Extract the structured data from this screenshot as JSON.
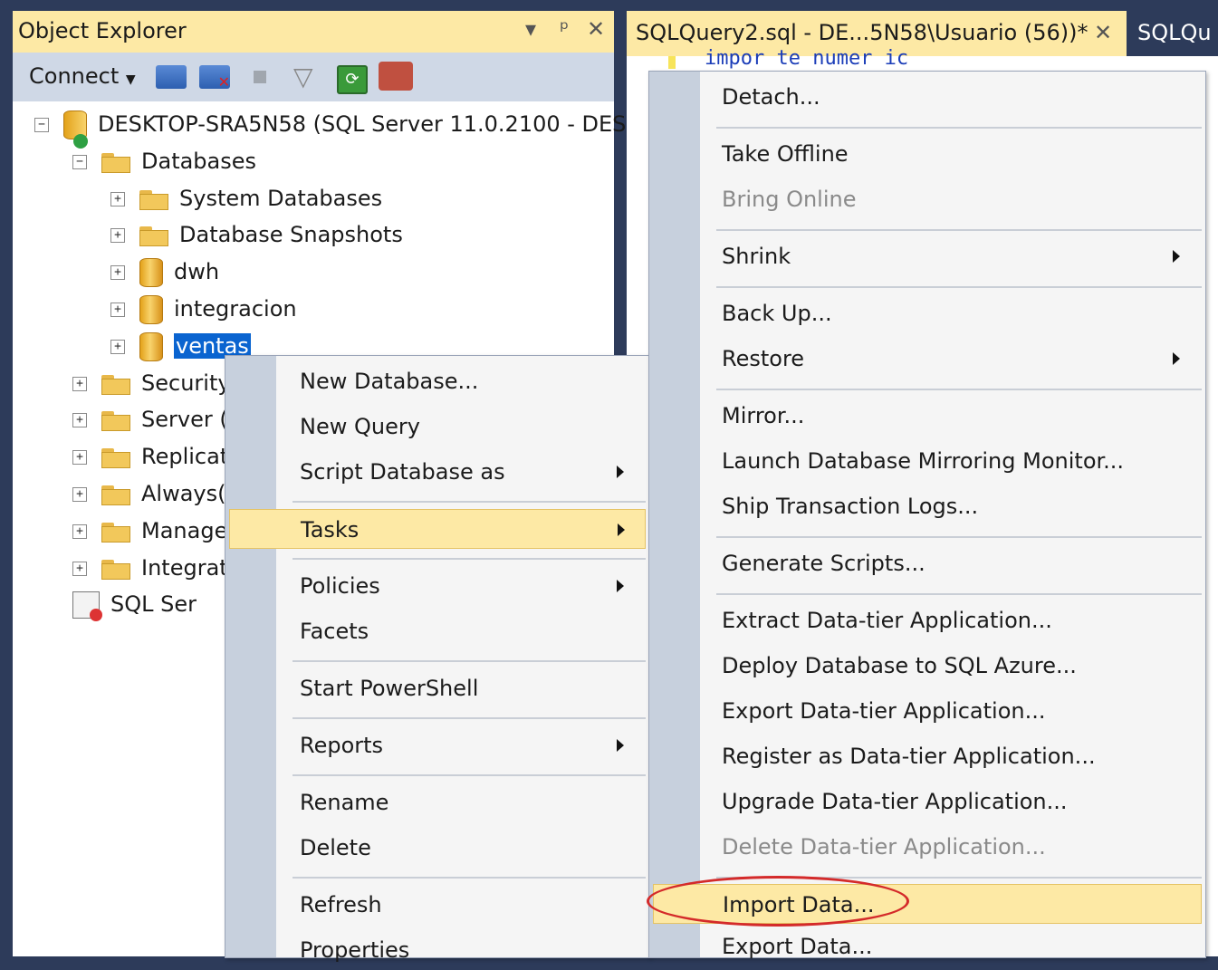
{
  "object_explorer": {
    "title": "Object Explorer",
    "title_buttons": [
      "▾",
      "ᵖ",
      "✕"
    ],
    "toolbar": {
      "connect_label": "Connect",
      "icons": [
        "connect-object-icon",
        "disconnect-icon",
        "stop-icon",
        "filter-icon",
        "refresh-icon",
        "summary-icon"
      ]
    },
    "tree": [
      {
        "label": "DESKTOP-SRA5N58 (SQL Server 11.0.2100 - DES",
        "expander": "−",
        "icon": "server-icon"
      },
      {
        "label": "Databases",
        "expander": "−",
        "icon": "folder-icon"
      },
      {
        "label": "System Databases",
        "expander": "+",
        "icon": "folder-icon"
      },
      {
        "label": "Database Snapshots",
        "expander": "+",
        "icon": "folder-icon"
      },
      {
        "label": "dwh",
        "expander": "+",
        "icon": "database-icon"
      },
      {
        "label": "integracion",
        "expander": "+",
        "icon": "database-icon"
      },
      {
        "label": "ventas",
        "expander": "+",
        "icon": "database-icon",
        "selected": true
      },
      {
        "label": "Security",
        "expander": "+",
        "icon": "folder-icon"
      },
      {
        "label": "Server (",
        "expander": "+",
        "icon": "folder-icon"
      },
      {
        "label": "Replicat",
        "expander": "+",
        "icon": "folder-icon"
      },
      {
        "label": "Always(",
        "expander": "+",
        "icon": "folder-icon"
      },
      {
        "label": "Manage",
        "expander": "+",
        "icon": "folder-icon"
      },
      {
        "label": "Integrat",
        "expander": "+",
        "icon": "folder-icon"
      },
      {
        "label": "SQL Ser",
        "expander": "",
        "icon": "agent-icon"
      }
    ]
  },
  "editor": {
    "tab_active": "SQLQuery2.sql - DE...5N58\\Usuario (56))*",
    "tab_close": "✕",
    "tab_next": "SQLQu",
    "code_fragment": "impor te numer ic"
  },
  "context_menu": {
    "items": [
      {
        "label": "New Database..."
      },
      {
        "label": "New Query"
      },
      {
        "label": "Script Database as",
        "submenu": true
      },
      {
        "label": "Tasks",
        "submenu": true,
        "highlighted": true
      },
      {
        "label": "Policies",
        "submenu": true
      },
      {
        "label": "Facets"
      },
      {
        "label": "Start PowerShell"
      },
      {
        "label": "Reports",
        "submenu": true
      },
      {
        "label": "Rename"
      },
      {
        "label": "Delete"
      },
      {
        "label": "Refresh"
      },
      {
        "label": "Properties"
      }
    ]
  },
  "tasks_menu": {
    "items": [
      {
        "label": "Detach..."
      },
      {
        "label": "Take Offline"
      },
      {
        "label": "Bring Online",
        "disabled": true
      },
      {
        "label": "Shrink",
        "submenu": true
      },
      {
        "label": "Back Up..."
      },
      {
        "label": "Restore",
        "submenu": true
      },
      {
        "label": "Mirror..."
      },
      {
        "label": "Launch Database Mirroring Monitor..."
      },
      {
        "label": "Ship Transaction Logs..."
      },
      {
        "label": "Generate Scripts..."
      },
      {
        "label": "Extract Data-tier Application..."
      },
      {
        "label": "Deploy Database to SQL Azure..."
      },
      {
        "label": "Export Data-tier Application..."
      },
      {
        "label": "Register as Data-tier Application..."
      },
      {
        "label": "Upgrade Data-tier Application..."
      },
      {
        "label": "Delete Data-tier Application...",
        "disabled": true
      },
      {
        "label": "Import Data...",
        "highlighted": true,
        "circled": true
      },
      {
        "label": "Export Data..."
      }
    ]
  },
  "colors": {
    "accent_highlight": "#fde9a5",
    "selection": "#0a64d0",
    "annotation": "#d42a2a",
    "frame": "#2d3b5a"
  }
}
